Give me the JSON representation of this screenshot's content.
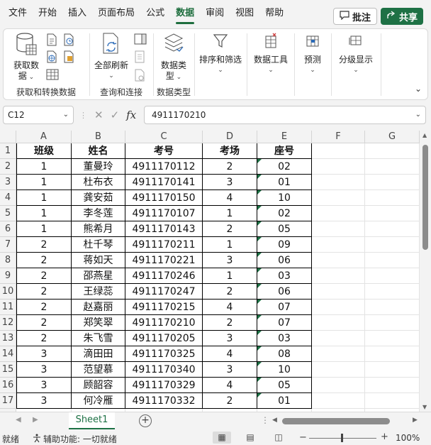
{
  "menu": {
    "items": [
      "文件",
      "开始",
      "插入",
      "页面布局",
      "公式",
      "数据",
      "审阅",
      "视图",
      "帮助"
    ],
    "active": "数据",
    "comment_label": "批注",
    "share_label": "共享"
  },
  "ribbon": {
    "groups": [
      {
        "label": "获取和转换数据",
        "button_label_1": "获取数",
        "button_label_2": "据"
      },
      {
        "label": "查询和连接",
        "button_label": "全部刷新"
      },
      {
        "label": "数据类型",
        "button_label_1": "数据类",
        "button_label_2": "型"
      },
      {
        "button_label": "排序和筛选"
      },
      {
        "button_label": "数据工具"
      },
      {
        "button_label": "预测"
      },
      {
        "button_label": "分级显示"
      }
    ]
  },
  "formula_bar": {
    "name_box": "C12",
    "formula": "4911170210"
  },
  "columns": [
    "A",
    "B",
    "C",
    "D",
    "E",
    "F",
    "G"
  ],
  "table": {
    "headers": [
      "班级",
      "姓名",
      "考号",
      "考场",
      "座号"
    ],
    "rows": [
      [
        "1",
        "董曼玲",
        "4911170112",
        "2",
        "02"
      ],
      [
        "1",
        "杜布衣",
        "4911170141",
        "3",
        "01"
      ],
      [
        "1",
        "龚安茹",
        "4911170150",
        "4",
        "10"
      ],
      [
        "1",
        "李冬莲",
        "4911170107",
        "1",
        "02"
      ],
      [
        "1",
        "熊希月",
        "4911170143",
        "2",
        "05"
      ],
      [
        "2",
        "杜千琴",
        "4911170211",
        "1",
        "09"
      ],
      [
        "2",
        "蒋如天",
        "4911170221",
        "3",
        "06"
      ],
      [
        "2",
        "邵燕星",
        "4911170246",
        "1",
        "03"
      ],
      [
        "2",
        "王绿蕊",
        "4911170247",
        "2",
        "06"
      ],
      [
        "2",
        "赵嘉丽",
        "4911170215",
        "4",
        "07"
      ],
      [
        "2",
        "郑笑翠",
        "4911170210",
        "2",
        "07"
      ],
      [
        "2",
        "朱飞雪",
        "4911170205",
        "3",
        "03"
      ],
      [
        "3",
        "滴田田",
        "4911170325",
        "4",
        "08"
      ],
      [
        "3",
        "范望慕",
        "4911170340",
        "3",
        "10"
      ],
      [
        "3",
        "顾韶容",
        "4911170329",
        "4",
        "05"
      ],
      [
        "3",
        "何冷雁",
        "4911170332",
        "2",
        "01"
      ]
    ]
  },
  "sheet_tabs": {
    "active": "Sheet1"
  },
  "status": {
    "ready": "就绪",
    "accessibility": "辅助功能: 一切就绪",
    "zoom": "100%"
  },
  "colors": {
    "accent": "#1e7145",
    "share_bg": "#1e7145"
  }
}
